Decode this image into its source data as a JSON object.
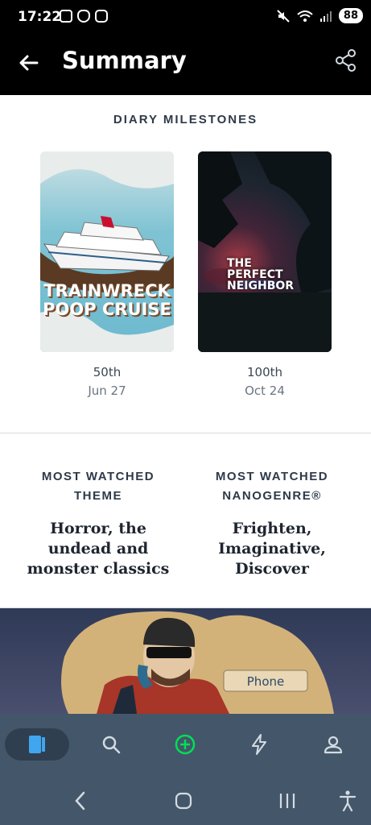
{
  "status_bar": {
    "time": "17:22",
    "battery": "88"
  },
  "header": {
    "title": "Summary"
  },
  "milestones": {
    "heading": "DIARY MILESTONES",
    "items": [
      {
        "poster_title": "TRAINWRECK POOP CRUISE",
        "count": "50th",
        "date": "Jun 27"
      },
      {
        "poster_title": "THE PERFECT NEIGHBOR",
        "count": "100th",
        "date": "Oct 24"
      }
    ]
  },
  "stats": {
    "theme_heading": "MOST WATCHED THEME",
    "theme_value": "Horror, the undead and monster classics",
    "nanogenre_heading": "MOST WATCHED NANOGENRE®",
    "nanogenre_value": "Frighten, Imaginative, Discover"
  },
  "illustration": {
    "phone_label": "Phone"
  },
  "bottom_nav": {
    "items": [
      "films-icon",
      "search-icon",
      "add-icon",
      "activity-icon",
      "profile-icon"
    ],
    "colors": {
      "active": "#40a6f0",
      "add": "#00e054",
      "icon": "#d4dbe2"
    }
  }
}
